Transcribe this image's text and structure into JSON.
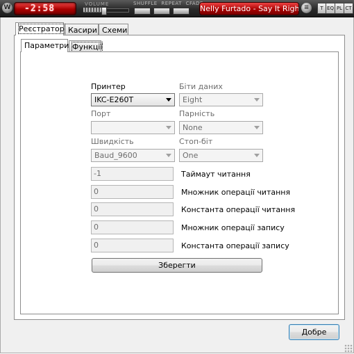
{
  "player": {
    "logo_glyph": "W",
    "time_display": "-2:58",
    "volume_label": "VOLUME",
    "volume_level": 0.46,
    "mode_labels": "SHUFFLE REPEAT CFADE",
    "track_title": "Nelly Furtado - Say It Right",
    "menu_glyph": "≡",
    "mini_buttons": [
      "T",
      "EQ",
      "PL",
      "CT"
    ]
  },
  "outer_tabs": [
    "Реєстратор",
    "Касири",
    "Схеми"
  ],
  "inner_tabs": [
    "Параметри",
    "Функції"
  ],
  "form": {
    "printer": {
      "label": "Принтер",
      "value": "IKC-E260T"
    },
    "data_bits": {
      "label": "Біти даних",
      "value": "Eight"
    },
    "port": {
      "label": "Порт",
      "value": ""
    },
    "parity": {
      "label": "Парність",
      "value": "None"
    },
    "speed": {
      "label": "Швидкість",
      "value": "Baud_9600"
    },
    "stop_bits": {
      "label": "Стоп-біт",
      "value": "One"
    },
    "read_timeout": {
      "label": "Таймаут читання",
      "value": "-1"
    },
    "read_multiplier": {
      "label": "Множник операції читання",
      "value": "0"
    },
    "read_constant": {
      "label": "Константа операції читання",
      "value": "0"
    },
    "write_multiplier": {
      "label": "Множник операції запису",
      "value": "0"
    },
    "write_constant": {
      "label": "Константа операції запису",
      "value": "0"
    },
    "save_label": "Зберегти"
  },
  "ok_label": "Добре"
}
